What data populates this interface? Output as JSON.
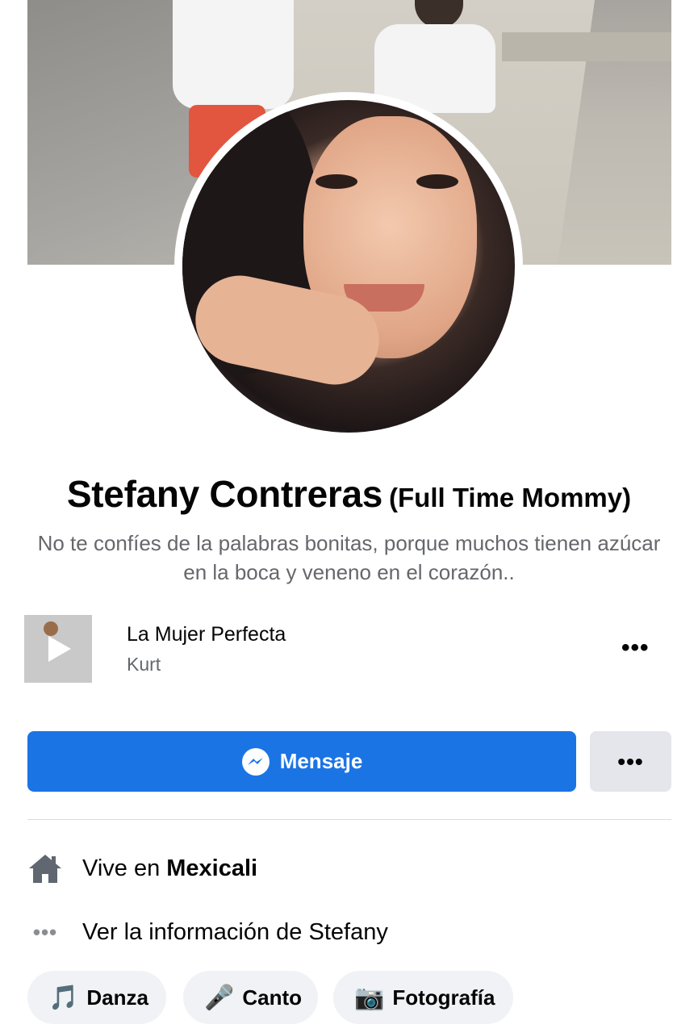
{
  "profile": {
    "name": "Stefany Contreras",
    "alternate_name": "(Full Time Mommy)",
    "bio": "No te confíes de la palabras bonitas, porque muchos tienen azúcar en la boca y veneno en el corazón.."
  },
  "music": {
    "title": "La Mujer Perfecta",
    "artist": "Kurt",
    "more_label": "•••"
  },
  "actions": {
    "message_label": "Mensaje",
    "more_label": "•••"
  },
  "details": {
    "lives_prefix": "Vive en ",
    "lives_city": "Mexicali",
    "see_info_label": "Ver la información de Stefany",
    "see_info_icon_text": "•••"
  },
  "hobbies": [
    {
      "emoji": "🎵",
      "label": "Danza"
    },
    {
      "emoji": "🎤",
      "label": "Canto"
    },
    {
      "emoji": "📷",
      "label": "Fotografía"
    }
  ],
  "colors": {
    "primary": "#1b74e4",
    "secondary_text": "#65676b",
    "button_grey": "#e4e6eb",
    "chip_bg": "#f0f2f5"
  },
  "icons": {
    "music_play": "play-icon",
    "messenger": "messenger-icon",
    "home": "home-icon",
    "more": "more-dots-icon"
  }
}
